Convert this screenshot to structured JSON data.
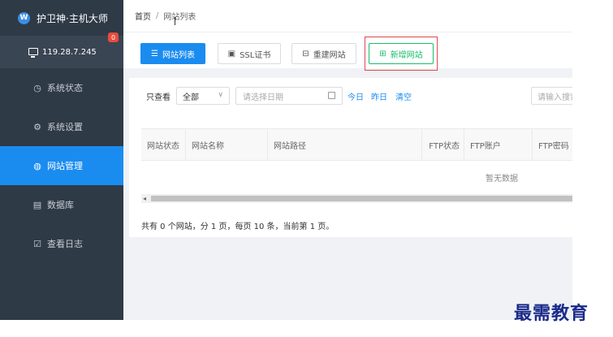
{
  "app": {
    "title": "护卫神·主机大师",
    "logo_letter": "W"
  },
  "host": {
    "ip": "119.28.7.245",
    "badge": "0"
  },
  "sidebar": {
    "items": [
      {
        "label": "系统状态",
        "icon": "clock-icon",
        "glyph": "◷",
        "active": false
      },
      {
        "label": "系统设置",
        "icon": "gear-icon",
        "glyph": "⚙",
        "active": false
      },
      {
        "label": "网站管理",
        "icon": "globe-icon",
        "glyph": "◍",
        "active": true
      },
      {
        "label": "数据库",
        "icon": "database-icon",
        "glyph": "▤",
        "active": false
      },
      {
        "label": "查看日志",
        "icon": "calendar-check-icon",
        "glyph": "☑",
        "active": false
      }
    ]
  },
  "breadcrumb": {
    "home": "首页",
    "sep": "/",
    "current": "网站列表"
  },
  "toolbar": {
    "site_list": "网站列表",
    "ssl": "SSL证书",
    "restart": "重建网站",
    "add": "新增网站"
  },
  "filter": {
    "label": "只查看",
    "select_value": "全部",
    "date_placeholder": "请选择日期",
    "today": "今日",
    "yesterday": "昨日",
    "clear": "清空",
    "search_placeholder": "请输入搜索"
  },
  "table": {
    "columns": [
      "网站状态",
      "网站名称",
      "网站路径",
      "FTP状态",
      "FTP账户",
      "FTP密码"
    ],
    "empty_text": "暂无数据"
  },
  "pagination": {
    "summary": "共有 0 个网站，分 1 页，每页 10 条，当前第 1 页。"
  },
  "watermark": "最需教育",
  "colors": {
    "sidebar_bg": "#2f3a47",
    "accent": "#1a8cf0",
    "success": "#19be6b",
    "highlight": "#e0484e"
  }
}
